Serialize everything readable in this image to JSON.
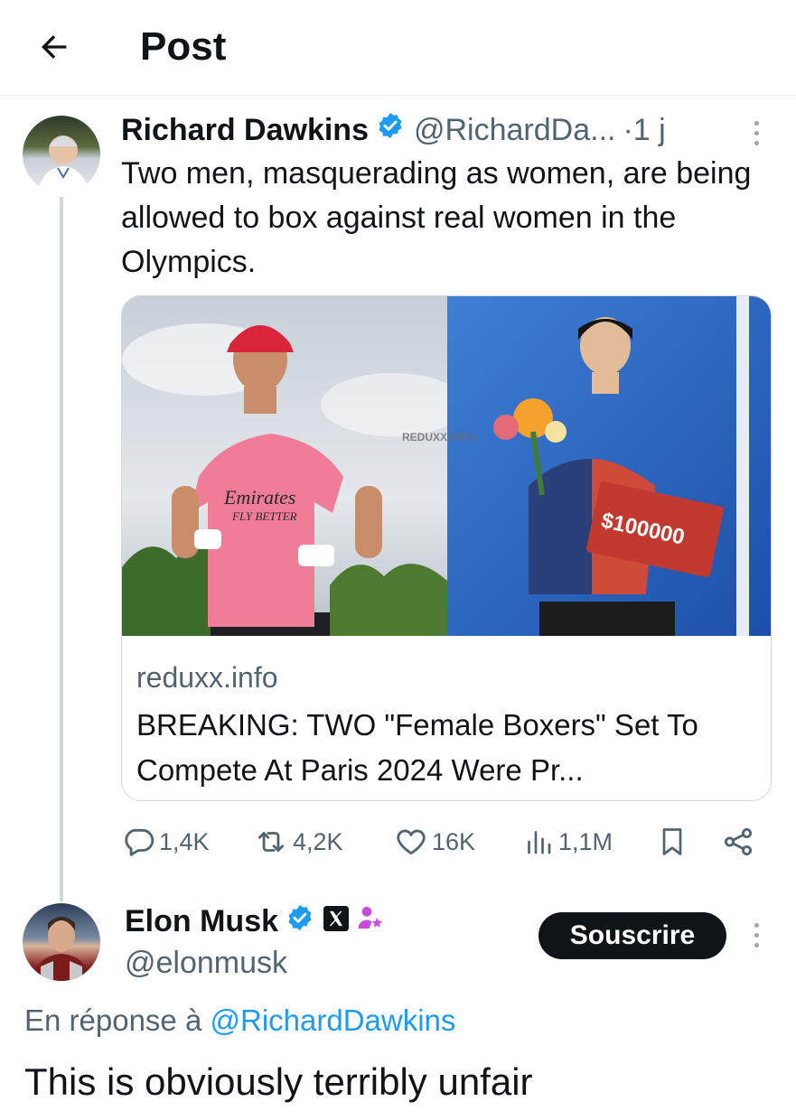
{
  "header": {
    "title": "Post"
  },
  "tweet": {
    "author_name": "Richard Dawkins",
    "author_handle": "@RichardDa...",
    "time": "·1 j",
    "text": "Two men, masquerading  as women, are being allowed to box against real women in the Olympics.",
    "card": {
      "image_watermark": "REDUXX.INFO",
      "image_jersey_text": "Emirates\nFLY BETTER",
      "image_check_text": "$100000",
      "domain": "reduxx.info",
      "title": "BREAKING: TWO \"Female Boxers\" Set To Compete At Paris 2024 Were Pr..."
    },
    "stats": {
      "replies": "1,4K",
      "reposts": "4,2K",
      "likes": "16K",
      "views": "1,1M"
    }
  },
  "reply": {
    "author_name": "Elon Musk",
    "author_handle": "@elonmusk",
    "subscribe_label": "Souscrire",
    "reply_prefix": "En réponse à",
    "reply_mention": "@RichardDawkins",
    "text": "This is obviously terribly unfair"
  },
  "colors": {
    "accent": "#1d9bf0",
    "text_primary": "#0f1419",
    "text_secondary": "#536471",
    "border": "#cfd9de",
    "affiliate_badge": "#c94bdc"
  },
  "icons": {
    "back": "arrow-left-icon",
    "verified": "verified-badge-icon",
    "reply": "speech-bubble-icon",
    "repost": "repost-arrows-icon",
    "like": "heart-icon",
    "views": "bar-chart-icon",
    "bookmark": "bookmark-icon",
    "share": "share-icon",
    "more": "more-vertical-icon",
    "x_logo": "x-logo-icon",
    "affiliate": "person-star-icon"
  }
}
